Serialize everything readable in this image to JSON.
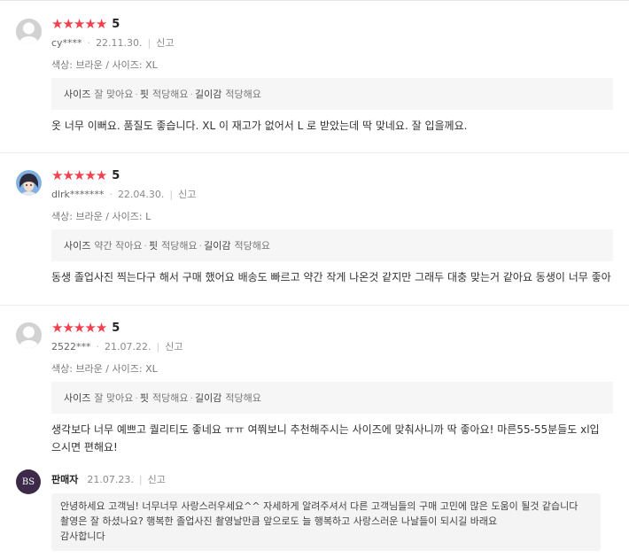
{
  "reviews": [
    {
      "score": "5",
      "user": "cy****",
      "date": "22.11.30.",
      "report": "신고",
      "options": "색상: 브라운 / 사이즈: XL",
      "fit": [
        {
          "k": "사이즈",
          "v": "잘 맞아요"
        },
        {
          "k": "핏",
          "v": "적당해요"
        },
        {
          "k": "길이감",
          "v": "적당해요"
        }
      ],
      "text": "옷 너무 이뻐요.  품질도 좋습니다.   XL 이 재고가 없어서 L 로 받았는데 딱 맞네요.  잘 입을께요.",
      "avatar": "default-avatar-icon"
    },
    {
      "score": "5",
      "user": "dlrk*******",
      "date": "22.04.30.",
      "report": "신고",
      "options": "색상: 브라운 / 사이즈: L",
      "fit": [
        {
          "k": "사이즈",
          "v": "약간 작아요"
        },
        {
          "k": "핏",
          "v": "적당해요"
        },
        {
          "k": "길이감",
          "v": "적당해요"
        }
      ],
      "text": "동생 졸업사진 찍는다구 해서 구매 했어요 배송도 빠르고 약간 작게 나온것 같지만 그래두 대충 맞는거 같아요 동생이 너무 좋아",
      "avatar": "character-avatar-icon"
    },
    {
      "score": "5",
      "user": "2522***",
      "date": "21.07.22.",
      "report": "신고",
      "options": "색상: 브라운 / 사이즈: XL",
      "fit": [
        {
          "k": "사이즈",
          "v": "잘 맞아요"
        },
        {
          "k": "핏",
          "v": "적당해요"
        },
        {
          "k": "길이감",
          "v": "적당해요"
        }
      ],
      "text_line1": "생각보다 너무 예쁘고 퀄리티도 좋네요 ㅠㅠ 여쭤보니 추천해주시는 사이즈에 맞춰사니까 딱 좋아요! 마른55-55분들도 xl입",
      "text_line2": "으시면 편해요!",
      "avatar": "default-avatar-icon"
    }
  ],
  "seller_reply": {
    "logo_text": "BS",
    "name": "판매자",
    "date": "21.07.23.",
    "report": "신고",
    "line1": "안녕하세요 고객님! 너무너무 사랑스러우세요^^ 자세하게 알려주셔서 다른 고객님들의 구매 고민에 많은 도움이 될것 같습니다",
    "line2": "촬영은 잘 하셨나요? 행복한 졸업사진 촬영날만큼 앞으로도 늘 행복하고 사랑스러운 나날들이 되시길 바래요",
    "line3": "감사합니다"
  },
  "colors": {
    "star": "#f2404d",
    "fit_bg": "#f6f6f6",
    "reply_bg": "#f4f4f4"
  }
}
